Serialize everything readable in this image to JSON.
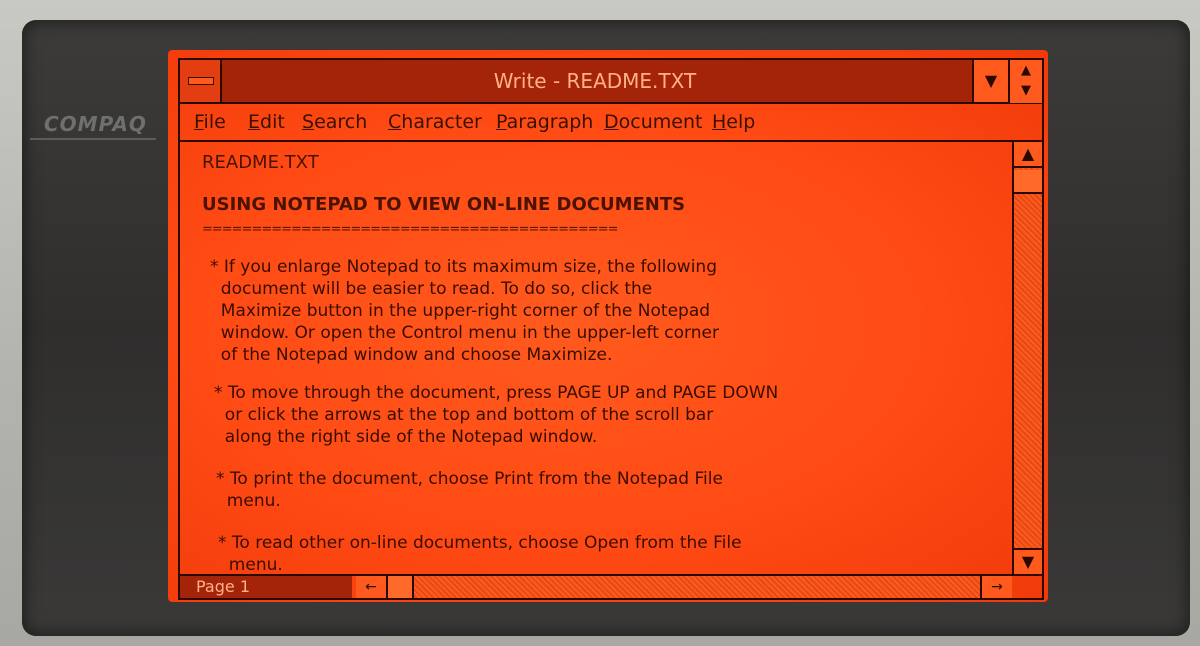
{
  "hardware": {
    "brand": "COMPAQ"
  },
  "window": {
    "title": "Write - README.TXT",
    "minimize_glyph": "▼",
    "maximize_glyph": "▲▼"
  },
  "menus": [
    {
      "label": "File",
      "accel": "F"
    },
    {
      "label": "Edit",
      "accel": "E"
    },
    {
      "label": "Search",
      "accel": "S"
    },
    {
      "label": "Character",
      "accel": "C"
    },
    {
      "label": "Paragraph",
      "accel": "P"
    },
    {
      "label": "Document",
      "accel": "D"
    },
    {
      "label": "Help",
      "accel": "H"
    }
  ],
  "document": {
    "filename": "README.TXT",
    "heading": "USING NOTEPAD TO VIEW ON-LINE DOCUMENTS",
    "rule": "==========================================",
    "paragraphs": [
      "* If you enlarge Notepad to its maximum size, the following\n  document will be easier to read. To do so, click the\n  Maximize button in the upper-right corner of the Notepad\n  window. Or open the Control menu in the upper-left corner\n  of the Notepad window and choose Maximize.",
      "* To move through the document, press PAGE UP and PAGE DOWN\n  or click the arrows at the top and bottom of the scroll bar\n  along the right side of the Notepad window.",
      "* To print the document, choose Print from the Notepad File\n  menu.",
      "* To read other on-line documents, choose Open from the File\n  menu."
    ]
  },
  "status": {
    "page": "Page 1"
  },
  "scrollbar": {
    "up_glyph": "▲",
    "down_glyph": "▼",
    "left_glyph": "←",
    "right_glyph": "→"
  },
  "colors": {
    "screen": "#ff4a14",
    "titlebar": "#a4240a",
    "text": "#3a0c00"
  }
}
